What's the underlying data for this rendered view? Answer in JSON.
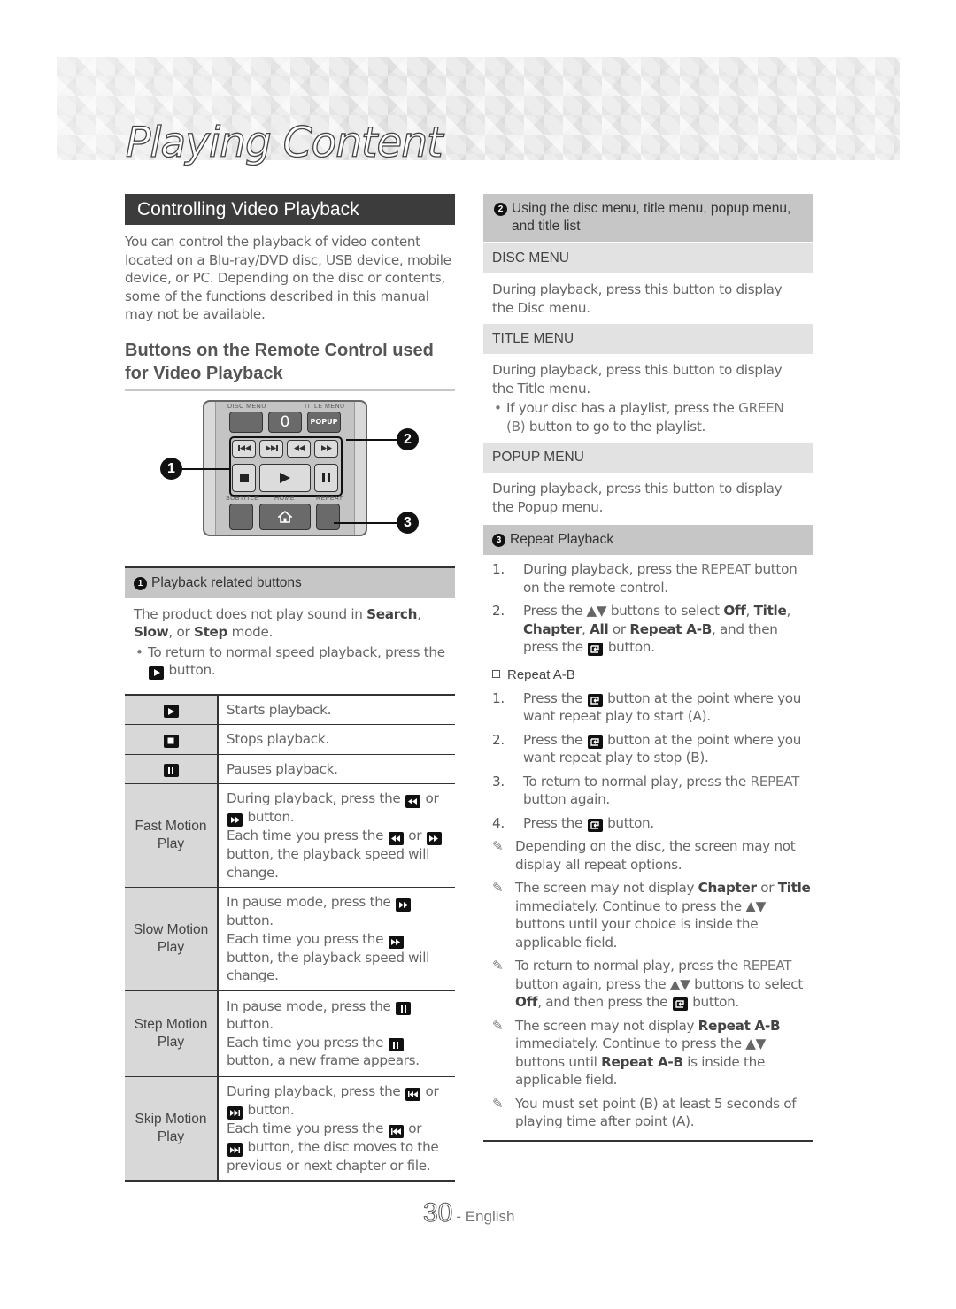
{
  "page": {
    "title": "Playing Content",
    "page_number": "30",
    "language": "- English"
  },
  "left": {
    "section_title": "Controlling Video Playback",
    "intro": "You can control the playback of video content located on a Blu-ray/DVD disc, USB device, mobile device, or PC. Depending on the disc or contents, some of the functions described in this manual may not be available.",
    "subheading": "Buttons on the Remote Control used for Video Playback",
    "remote": {
      "labels": {
        "disc_menu": "DISC MENU",
        "title_menu": "TITLE MENU",
        "zero": "0",
        "popup": "POPUP",
        "subtitle": "SUBTITLE",
        "home": "HOME",
        "repeat": "REPEAT"
      },
      "callouts": [
        "1",
        "2",
        "3"
      ]
    },
    "playback_box": {
      "badge": "1",
      "title": "Playback related buttons",
      "text_pre": "The product does not play sound in ",
      "search": "Search",
      "comma1": ", ",
      "slow": "Slow",
      "comma2": ", or ",
      "step": "Step",
      "text_post": " mode.",
      "bullet_pre": "To return to normal speed playback, press the",
      "bullet_post": " button."
    },
    "table": {
      "rows": [
        {
          "key_icon": "play-icon",
          "text": "Starts playback."
        },
        {
          "key_icon": "stop-icon",
          "text": "Stops playback."
        },
        {
          "key_icon": "pause-icon",
          "text": "Pauses playback."
        },
        {
          "key": "Fast Motion Play",
          "line1_pre": "During playback, press the",
          "line1_mid": " or",
          "line1_post": " button.",
          "line2_pre": "Each time you press the",
          "line2_mid": " or",
          "line2_post": " button, the playback speed will change."
        },
        {
          "key": "Slow Motion Play",
          "line1_pre": "In pause mode, press the",
          "line1_post": " button.",
          "line2_pre": "Each time you press the",
          "line2_post": " button, the playback speed will change."
        },
        {
          "key": "Step Motion Play",
          "line1_pre": "In pause mode, press the",
          "line1_post": " button.",
          "line2_pre": "Each time you press the",
          "line2_post": " button, a new frame appears."
        },
        {
          "key": "Skip Motion Play",
          "line1_pre": "During playback, press the",
          "line1_mid": " or",
          "line1_post": " button.",
          "line2_pre": "Each time you press the",
          "line2_mid": " or",
          "line2_post": " button, the disc moves to the previous or next chapter or file."
        }
      ]
    }
  },
  "right": {
    "menu_box": {
      "badge": "2",
      "title": "Using the disc menu, title menu, popup menu, and title list",
      "disc_menu": {
        "head": "DISC MENU",
        "text": "During playback, press this button to display the Disc menu."
      },
      "title_menu": {
        "head": "TITLE MENU",
        "text": "During playback, press this button to display the Title menu.",
        "bullet_pre": "If your disc has a playlist, press the ",
        "bullet_green": "GREEN (B)",
        "bullet_post": " button to go to the playlist."
      },
      "popup_menu": {
        "head": "POPUP MENU",
        "text": "During playback, press this button to display the Popup menu."
      }
    },
    "repeat_box": {
      "badge": "3",
      "title": "Repeat Playback",
      "steps": [
        {
          "n": "1.",
          "pre": "During playback, press the ",
          "kw": "REPEAT",
          "post": " button on the remote control."
        },
        {
          "n": "2.",
          "pre": "Press the ▲▼ buttons to select ",
          "opts": [
            "Off",
            "Title",
            "Chapter",
            "All",
            "Repeat A-B"
          ],
          "post": ", and then press the",
          "post2": " button."
        }
      ],
      "ab_heading": "Repeat A-B",
      "ab_steps": [
        {
          "n": "1.",
          "pre": "Press the",
          "post": " button at the point where you want repeat play to start (A)."
        },
        {
          "n": "2.",
          "pre": "Press the",
          "post": " button at the point where you want repeat play to stop (B)."
        },
        {
          "n": "3.",
          "pre": "To return to normal play, press the ",
          "kw": "REPEAT",
          "post": " button again."
        },
        {
          "n": "4.",
          "pre": "Press the",
          "post": " button."
        }
      ],
      "notes": [
        {
          "text": "Depending on the disc, the screen may not display all repeat options."
        },
        {
          "pre": "The screen may not display ",
          "b1": "Chapter",
          "mid": " or ",
          "b2": "Title",
          "post": " immediately. Continue to press the ▲▼ buttons until your choice is inside the applicable field."
        },
        {
          "pre": "To return to normal play, press the ",
          "kw": "REPEAT",
          "mid": " button again, press the ▲▼ buttons to select ",
          "b1": "Off",
          "post": ", and then press the",
          "post2": " button."
        },
        {
          "pre": "The screen may not display ",
          "b1": "Repeat A-B",
          "mid": " immediately. Continue to press the ▲▼ buttons until ",
          "b2": "Repeat A-B",
          "post": " is inside the applicable field."
        },
        {
          "text": "You must set point (B) at least 5 seconds of playing time after point (A)."
        }
      ]
    }
  },
  "colors": {
    "section_bar": "#3c3c3c",
    "box_header": "#c6c6c6",
    "sub_header": "#e2e2e2",
    "table_key_bg": "#d8d8d8",
    "body_text": "#666666"
  }
}
